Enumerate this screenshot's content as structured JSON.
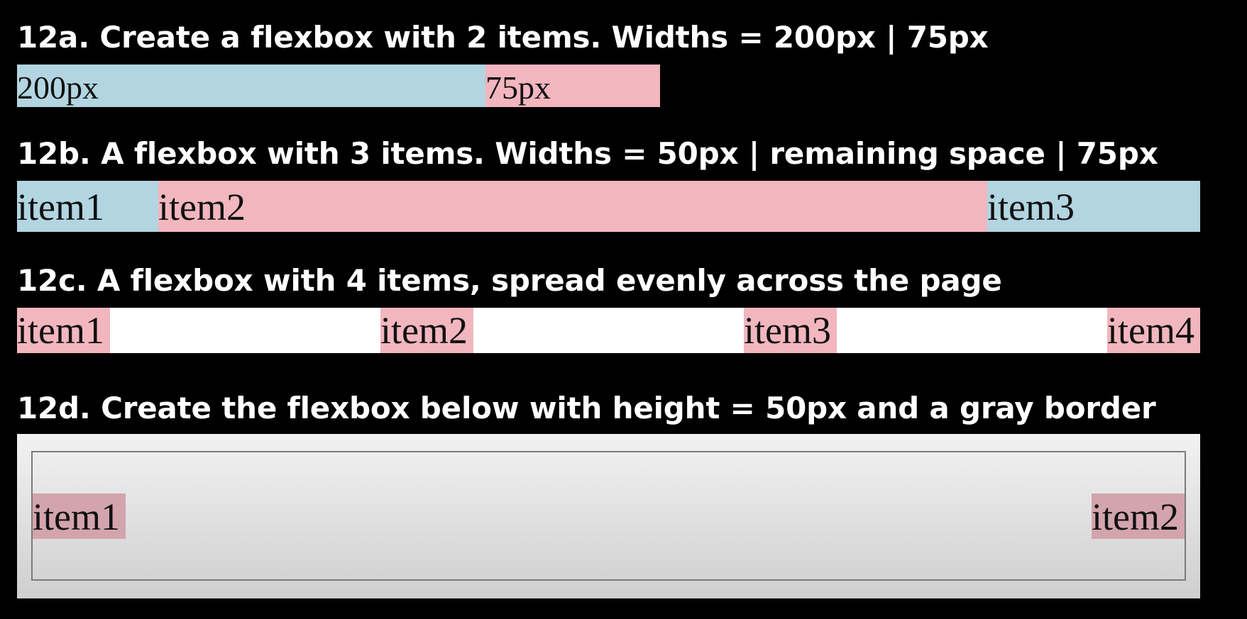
{
  "exercises": [
    {
      "heading": "12a. Create a flexbox with 2 items. Widths = 200px | 75px",
      "items": [
        "200px",
        "75px"
      ]
    },
    {
      "heading": "12b. A flexbox with 3 items. Widths = 50px | remaining space | 75px",
      "items": [
        "item1",
        "item2",
        "item3"
      ]
    },
    {
      "heading": "12c. A flexbox with 4 items, spread evenly across the page",
      "items": [
        "item1",
        "item2",
        "item3",
        "item4"
      ]
    },
    {
      "heading": "12d. Create the flexbox below with height = 50px and a gray border",
      "items": [
        "item1",
        "item2"
      ]
    }
  ],
  "colors": {
    "background": "#000000",
    "blue_item": "#b2d5e1",
    "pink_item": "#f2b6bf",
    "rose_item": "#d3a4ad",
    "border_gray": "#7b7b7b"
  }
}
